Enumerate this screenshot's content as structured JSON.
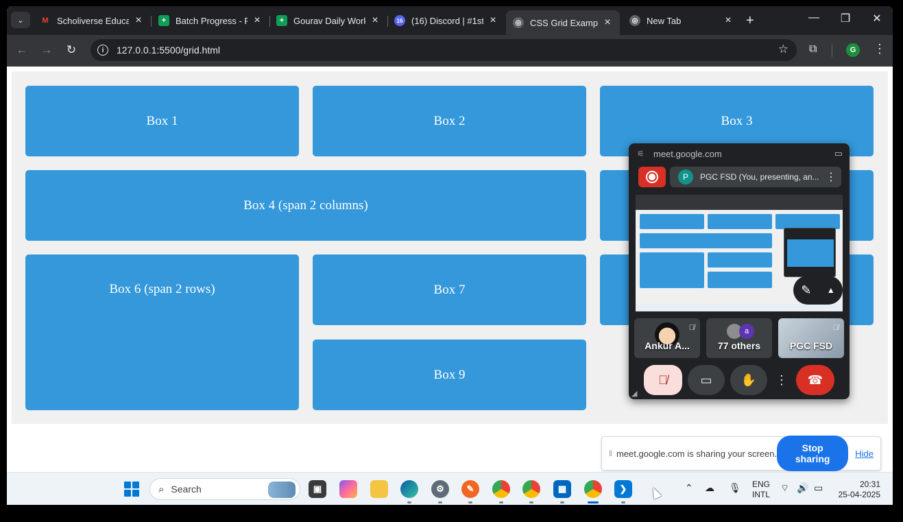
{
  "browser": {
    "tabs": [
      {
        "title": "Scholiverse Educar",
        "icon": "gmail-icon",
        "color": "#ea4335",
        "glyph": "M"
      },
      {
        "title": "Batch Progress - FS",
        "icon": "sheets-icon",
        "color": "#0f9d58",
        "glyph": "+"
      },
      {
        "title": "Gourav Daily Work",
        "icon": "sheets-icon",
        "color": "#0f9d58",
        "glyph": "+"
      },
      {
        "title": "(16) Discord | #1st",
        "icon": "discord-icon",
        "color": "#5865f2",
        "glyph": "16"
      },
      {
        "title": "CSS Grid Example",
        "icon": "globe-icon",
        "color": "#5f6368",
        "glyph": "◎"
      },
      {
        "title": "New Tab",
        "icon": "chrome-icon",
        "color": "#5f6368",
        "glyph": "◎"
      }
    ],
    "active_tab": 4,
    "url": "127.0.0.1:5500/grid.html",
    "profile_initial": "G"
  },
  "grid": {
    "box1": "Box 1",
    "box2": "Box 2",
    "box3": "Box 3",
    "box4": "Box 4 (span 2 columns)",
    "box6": "Box 6 (span 2 rows)",
    "box7": "Box 7",
    "box9": "Box 9"
  },
  "meet_pip": {
    "site": "meet.google.com",
    "presenter_avatar": "P",
    "presenter_text": "PGC FSD (You, presenting, an...",
    "tiles": [
      {
        "name": "Ankur A..."
      },
      {
        "name": "77 others",
        "avatar": "a"
      },
      {
        "name": "PGC FSD"
      }
    ]
  },
  "share_bar": {
    "message": "meet.google.com is sharing your screen.",
    "stop_label": "Stop sharing",
    "hide_label": "Hide"
  },
  "taskbar": {
    "search_label": "Search",
    "lang_line1": "ENG",
    "lang_line2": "INTL",
    "time": "20:31",
    "date": "25-04-2025"
  },
  "colors": {
    "box": "#3498db",
    "container": "#f0f0f0",
    "accent": "#1a73e8",
    "hangup": "#d93025"
  }
}
